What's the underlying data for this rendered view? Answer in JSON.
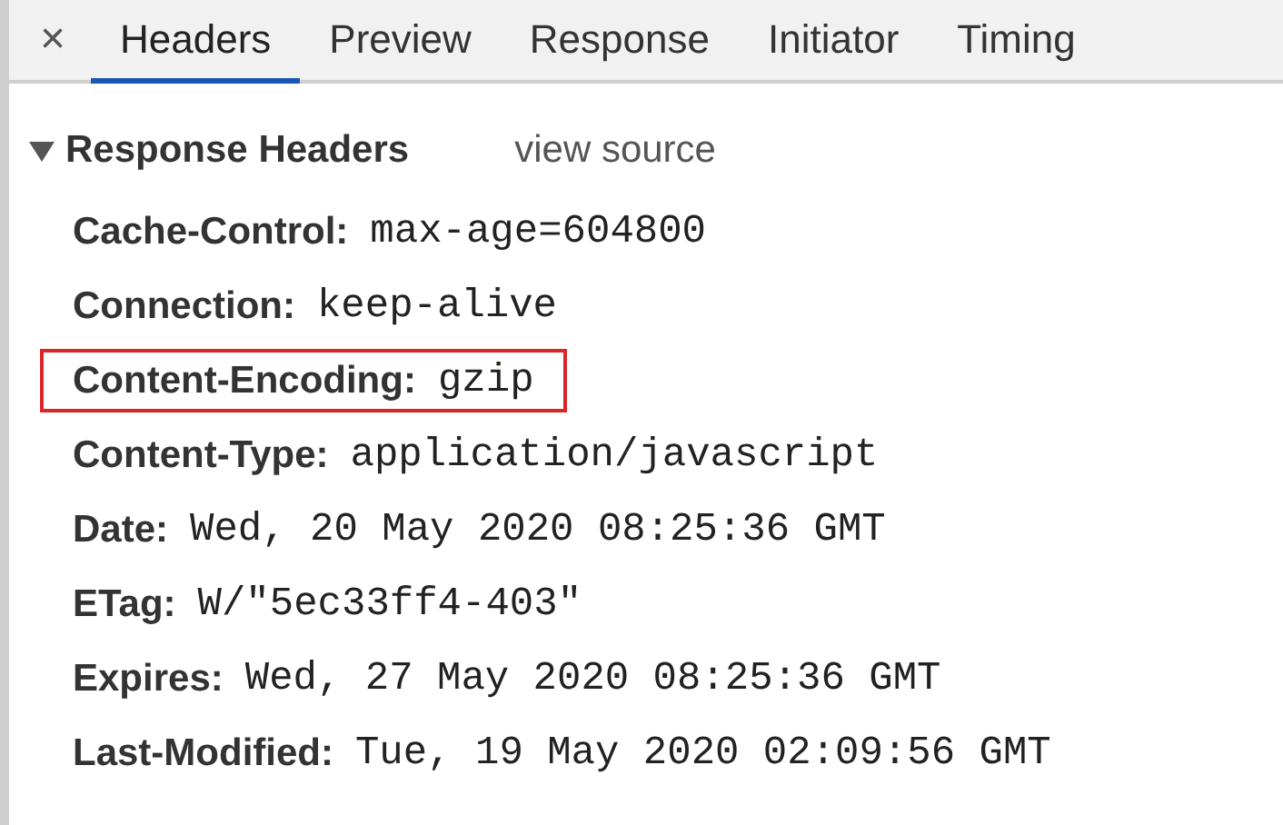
{
  "tabs": [
    {
      "label": "Headers",
      "selected": true
    },
    {
      "label": "Preview",
      "selected": false
    },
    {
      "label": "Response",
      "selected": false
    },
    {
      "label": "Initiator",
      "selected": false
    },
    {
      "label": "Timing",
      "selected": false
    }
  ],
  "close_label": "×",
  "section": {
    "title": "Response Headers",
    "expanded": true,
    "link": "view source",
    "headers": [
      {
        "name": "Cache-Control:",
        "value": "max-age=604800",
        "highlighted": false
      },
      {
        "name": "Connection:",
        "value": "keep-alive",
        "highlighted": false
      },
      {
        "name": "Content-Encoding:",
        "value": "gzip",
        "highlighted": true
      },
      {
        "name": "Content-Type:",
        "value": "application/javascript",
        "highlighted": false
      },
      {
        "name": "Date:",
        "value": "Wed, 20 May 2020 08:25:36 GMT",
        "highlighted": false
      },
      {
        "name": "ETag:",
        "value": "W/\"5ec33ff4-403\"",
        "highlighted": false
      },
      {
        "name": "Expires:",
        "value": "Wed, 27 May 2020 08:25:36 GMT",
        "highlighted": false
      },
      {
        "name": "Last-Modified:",
        "value": "Tue, 19 May 2020 02:09:56 GMT",
        "highlighted": false
      }
    ]
  }
}
